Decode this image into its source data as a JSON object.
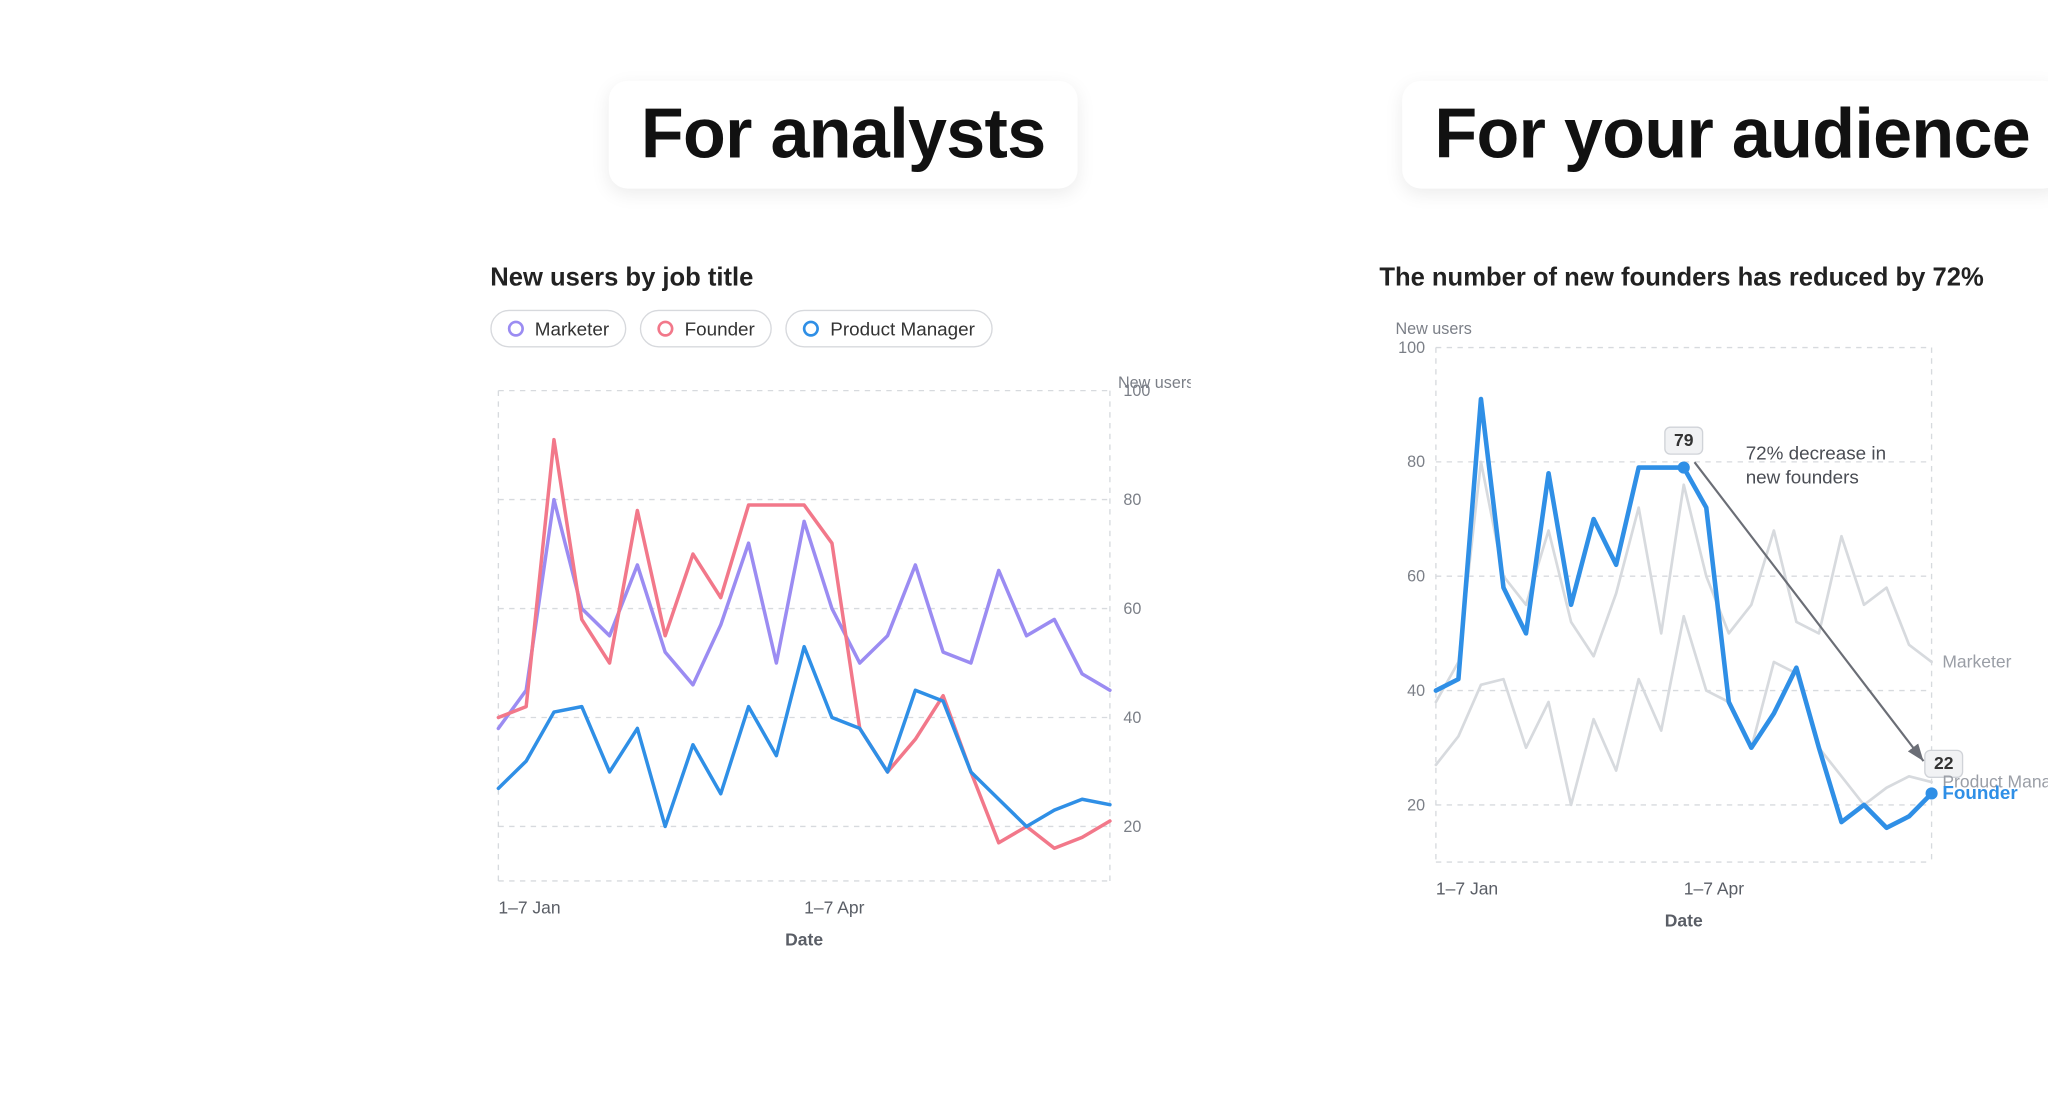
{
  "headings": {
    "left": "For analysts",
    "right": "For your audience"
  },
  "chart_data": [
    {
      "id": "analyst",
      "type": "line",
      "title": "New users by job title",
      "xlabel": "Date",
      "ylabel": "New users",
      "ylim": [
        10,
        100
      ],
      "x_positions": [
        0,
        1,
        2,
        3,
        4,
        5,
        6,
        7,
        8,
        9,
        10,
        11,
        12,
        13,
        14,
        15,
        16,
        17,
        18,
        19,
        20,
        21,
        22
      ],
      "x_tick_indices": [
        0,
        11
      ],
      "x_tick_labels": [
        "1–7 Jan",
        "1–7 Apr"
      ],
      "y_ticks": [
        20,
        40,
        60,
        80,
        100
      ],
      "series": [
        {
          "name": "Marketer",
          "color": "#9b8cf2",
          "values": [
            38,
            45,
            80,
            60,
            55,
            68,
            52,
            46,
            57,
            72,
            50,
            76,
            60,
            50,
            55,
            68,
            52,
            50,
            67,
            55,
            58,
            48,
            45
          ]
        },
        {
          "name": "Founder",
          "color": "#f2788a",
          "values": [
            40,
            42,
            91,
            58,
            50,
            78,
            55,
            70,
            62,
            79,
            79,
            79,
            72,
            38,
            30,
            36,
            44,
            30,
            17,
            20,
            16,
            18,
            21
          ]
        },
        {
          "name": "Product Manager",
          "color": "#2f8fe6",
          "values": [
            27,
            32,
            41,
            42,
            30,
            38,
            20,
            35,
            26,
            42,
            33,
            53,
            40,
            38,
            30,
            45,
            43,
            30,
            25,
            20,
            23,
            25,
            24
          ]
        }
      ]
    },
    {
      "id": "audience",
      "type": "line",
      "title": "The number of new founders has reduced by 72%",
      "xlabel": "Date",
      "ylabel": "New users",
      "ylim": [
        10,
        100
      ],
      "x_positions": [
        0,
        1,
        2,
        3,
        4,
        5,
        6,
        7,
        8,
        9,
        10,
        11,
        12,
        13,
        14,
        15,
        16,
        17,
        18,
        19,
        20,
        21,
        22
      ],
      "x_tick_indices": [
        0,
        11
      ],
      "x_tick_labels": [
        "1–7 Jan",
        "1–7 Apr"
      ],
      "y_ticks": [
        20,
        40,
        60,
        80,
        100
      ],
      "highlight_series": "Founder",
      "series": [
        {
          "name": "Marketer",
          "color": "#9b8cf2",
          "values": [
            38,
            45,
            80,
            60,
            55,
            68,
            52,
            46,
            57,
            72,
            50,
            76,
            60,
            50,
            55,
            68,
            52,
            50,
            67,
            55,
            58,
            48,
            45
          ]
        },
        {
          "name": "Founder",
          "color": "#2f8fe6",
          "values": [
            40,
            42,
            91,
            58,
            50,
            78,
            55,
            70,
            62,
            79,
            79,
            79,
            72,
            38,
            30,
            36,
            44,
            30,
            17,
            20,
            16,
            18,
            22
          ]
        },
        {
          "name": "Product Manager",
          "color": "#2f8fe6",
          "values": [
            27,
            32,
            41,
            42,
            30,
            38,
            20,
            35,
            26,
            42,
            33,
            53,
            40,
            38,
            30,
            45,
            43,
            30,
            25,
            20,
            23,
            25,
            24
          ]
        }
      ],
      "annotations": {
        "start_point": {
          "x_index": 11,
          "value": 79,
          "label": "79"
        },
        "end_point": {
          "x_index": 22,
          "value": 22,
          "label": "22"
        },
        "arrow_text_lines": [
          "72% decrease in",
          "new founders"
        ],
        "end_labels": [
          {
            "text": "Marketer",
            "series": "Marketer"
          },
          {
            "text": "Product Manager",
            "series": "Product Manager"
          },
          {
            "text": "Founder",
            "series": "Founder",
            "emphasized": true
          }
        ]
      }
    }
  ]
}
